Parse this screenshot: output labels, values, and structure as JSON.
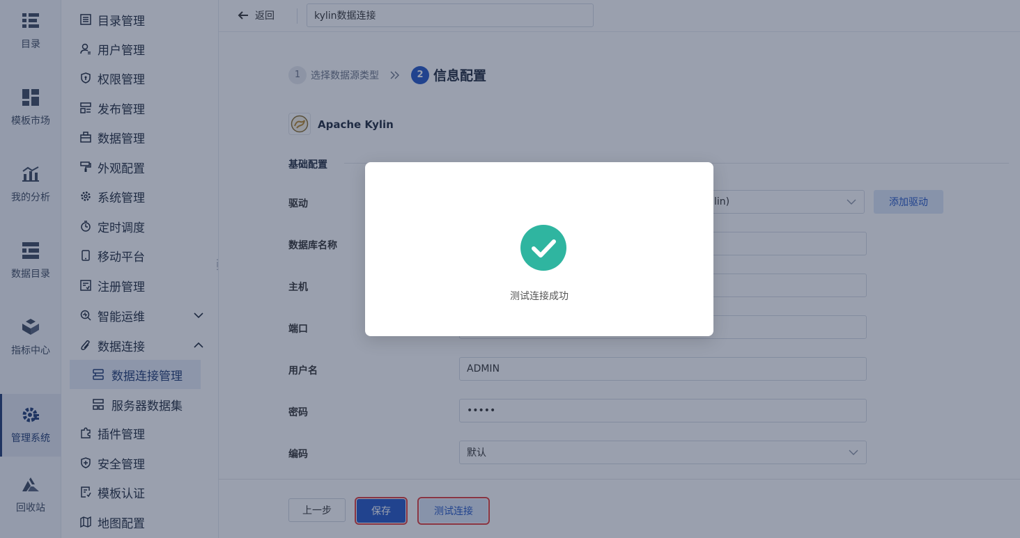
{
  "rail": {
    "items": [
      {
        "label": "目录",
        "icon": "list-icon"
      },
      {
        "label": "模板市场",
        "icon": "dashboard-icon"
      },
      {
        "label": "我的分析",
        "icon": "analysis-icon"
      },
      {
        "label": "数据目录",
        "icon": "data-catalog-icon"
      },
      {
        "label": "指标中心",
        "icon": "cube-icon"
      },
      {
        "label": "管理系统",
        "icon": "gear-icon",
        "active": true
      },
      {
        "label": "回收站",
        "icon": "recycle-icon"
      }
    ]
  },
  "menu": {
    "items": [
      {
        "label": "目录管理",
        "icon": "catalog-icon"
      },
      {
        "label": "用户管理",
        "icon": "user-icon"
      },
      {
        "label": "权限管理",
        "icon": "shield-icon"
      },
      {
        "label": "发布管理",
        "icon": "publish-icon"
      },
      {
        "label": "数据管理",
        "icon": "briefcase-icon"
      },
      {
        "label": "外观配置",
        "icon": "paint-roller-icon"
      },
      {
        "label": "系统管理",
        "icon": "settings-icon"
      },
      {
        "label": "定时调度",
        "icon": "timer-icon"
      },
      {
        "label": "移动平台",
        "icon": "mobile-icon"
      },
      {
        "label": "注册管理",
        "icon": "register-icon"
      },
      {
        "label": "智能运维",
        "icon": "ops-icon"
      },
      {
        "label": "数据连接",
        "icon": "link-icon"
      },
      {
        "label": "插件管理",
        "icon": "puzzle-icon"
      },
      {
        "label": "安全管理",
        "icon": "security-icon"
      },
      {
        "label": "模板认证",
        "icon": "certificate-icon"
      },
      {
        "label": "地图配置",
        "icon": "map-icon"
      }
    ],
    "sub_items": [
      {
        "label": "数据连接管理",
        "icon": "db-connection-icon",
        "active": true
      },
      {
        "label": "服务器数据集",
        "icon": "server-dataset-icon"
      }
    ]
  },
  "topbar": {
    "back_label": "返回",
    "title_value": "kylin数据连接"
  },
  "steps": [
    {
      "num": "1",
      "label": "选择数据源类型"
    },
    {
      "num": "2",
      "label": "信息配置"
    }
  ],
  "datasource": {
    "name": "Apache Kylin"
  },
  "section": {
    "title": "基础配置"
  },
  "form": {
    "driver_label": "驱动",
    "driver_value": "lin)",
    "add_driver": "添加驱动",
    "dbname_label": "数据库名称",
    "host_label": "主机",
    "port_label": "端口",
    "username_label": "用户名",
    "username_value": "ADMIN",
    "password_label": "密码",
    "password_value": "•••••",
    "encoding_label": "编码",
    "encoding_value": "默认"
  },
  "footer": {
    "prev": "上一步",
    "save": "保存",
    "test": "测试连接"
  },
  "modal": {
    "message": "测试连接成功"
  },
  "colors": {
    "primary": "#2457c5",
    "success": "#2fb5a0",
    "highlight_outline": "#e03b3b"
  }
}
